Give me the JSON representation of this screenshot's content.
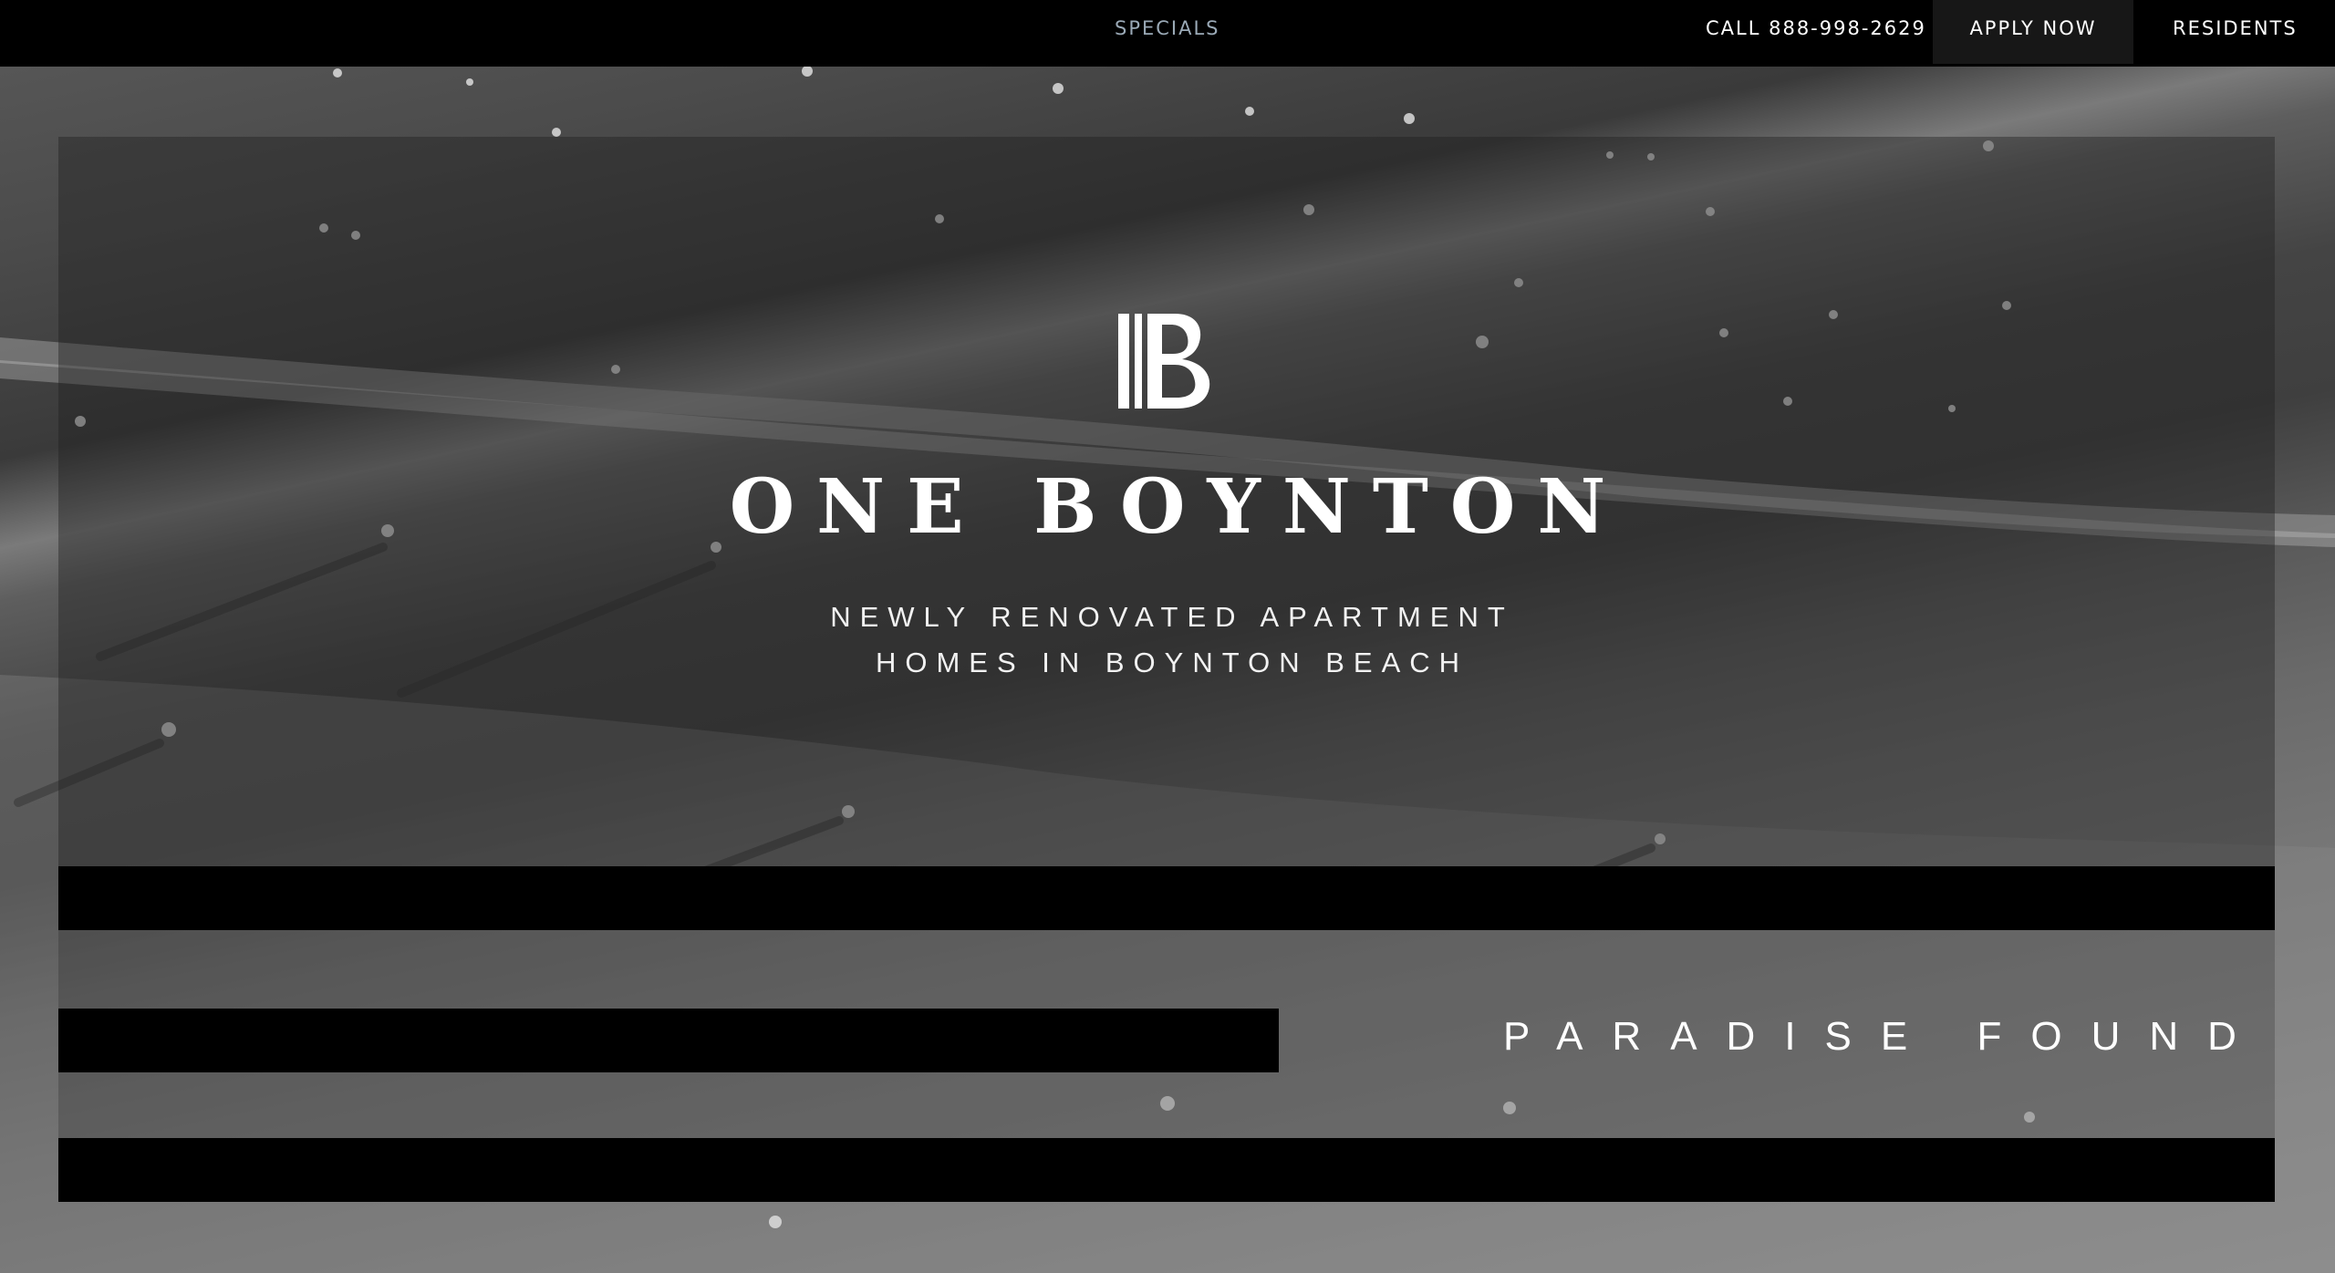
{
  "nav": {
    "specials": "SPECIALS",
    "call": "CALL 888-998-2629",
    "apply": "APPLY NOW",
    "residents": "RESIDENTS"
  },
  "hero": {
    "logo_monogram": "B",
    "title": "ONE BOYNTON",
    "tagline_line1": "NEWLY RENOVATED APARTMENT",
    "tagline_line2": "HOMES IN BOYNTON BEACH",
    "icon": "ob-monogram-logo"
  },
  "section": {
    "heading": "PARADISE FOUND"
  },
  "colors": {
    "nav_bg": "#000000",
    "apply_bg": "#171717",
    "specials_text": "#9aa9b6",
    "text": "#ffffff"
  }
}
